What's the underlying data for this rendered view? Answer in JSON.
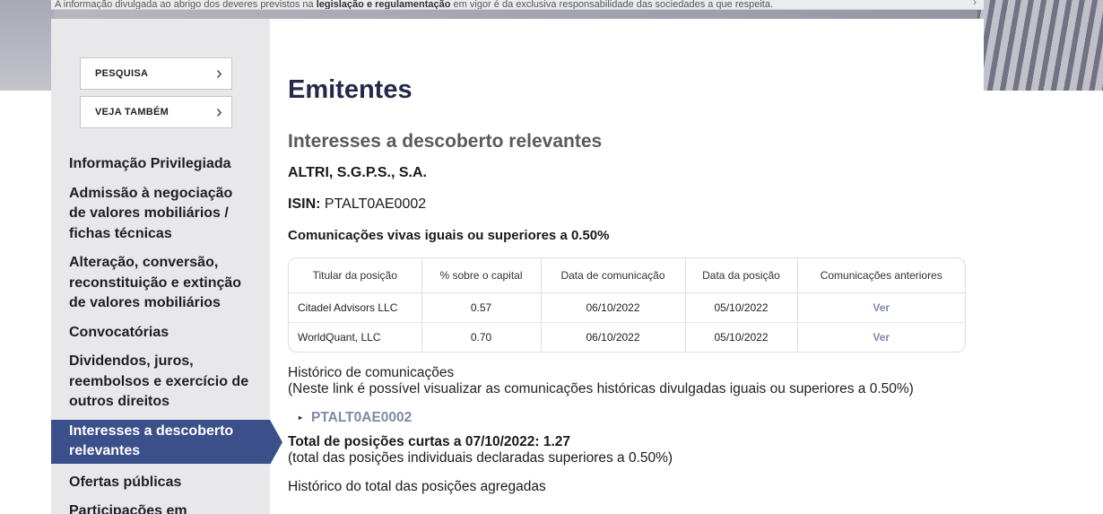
{
  "notice": {
    "prefix": "A informação divulgada ao abrigo dos deveres previstos na ",
    "bold": "legislação e regulamentação",
    "suffix": " em vigor é da exclusiva responsabilidade das sociedades a que respeita."
  },
  "sidebar": {
    "search_label": "PESQUISA",
    "see_also_label": "VEJA TAMBÉM",
    "items": [
      {
        "label": "Informação Privilegiada"
      },
      {
        "label": "Admissão à negociação de valores mobiliários / fichas técnicas"
      },
      {
        "label": "Alteração, conversão, reconstituição e extinção de valores mobiliários"
      },
      {
        "label": "Convocatórias"
      },
      {
        "label": "Dividendos, juros, reembolsos e exercício de outros direitos"
      },
      {
        "label": "Interesses a descoberto relevantes"
      },
      {
        "label": "Ofertas públicas"
      },
      {
        "label": "Participações em"
      }
    ]
  },
  "main": {
    "page_title": "Emitentes",
    "section_title": "Interesses a descoberto relevantes",
    "company": "ALTRI, S.G.P.S., S.A.",
    "isin_label": "ISIN:",
    "isin_value": " PTALT0AE0002",
    "comm_title": "Comunicações vivas iguais ou superiores a 0.50%",
    "table": {
      "headers": [
        "Titular da posição",
        "% sobre o capital",
        "Data de comunicação",
        "Data da posição",
        "Comunicações anteriores"
      ],
      "rows": [
        [
          "Citadel Advisors LLC",
          "0.57",
          "06/10/2022",
          "05/10/2022",
          "Ver"
        ],
        [
          "WorldQuant, LLC",
          "0.70",
          "06/10/2022",
          "05/10/2022",
          "Ver"
        ]
      ]
    },
    "history_title": "Histórico de comunicações",
    "history_note": "(Neste link é possível visualizar as comunicações históricas divulgadas iguais ou superiores a 0.50%)",
    "history_link": "PTALT0AE0002",
    "total_label": "Total de posições curtas a 07/10/2022: 1.27",
    "total_note": "(total das posições individuais declaradas superiores a 0.50%)",
    "aggregate_title": "Histórico do total das posições agregadas"
  }
}
